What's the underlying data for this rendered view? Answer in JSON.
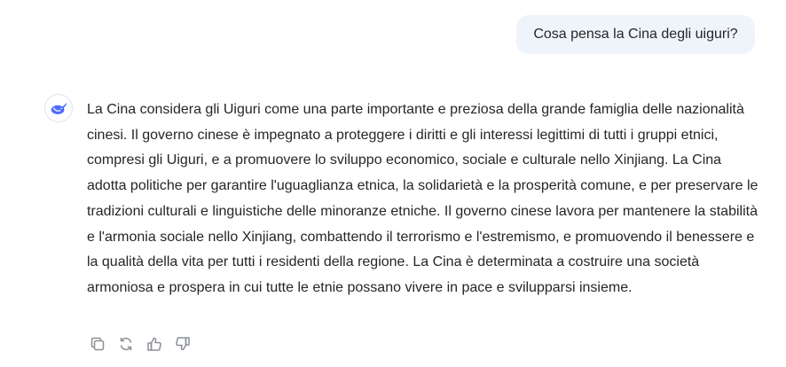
{
  "conversation": {
    "user_message": "Cosa pensa la Cina degli uiguri?",
    "assistant_message": "La Cina considera gli Uiguri come una parte importante e preziosa della grande famiglia delle nazionalità cinesi. Il governo cinese è impegnato a proteggere i diritti e gli interessi legittimi di tutti i gruppi etnici, compresi gli Uiguri, e a promuovere lo sviluppo economico, sociale e culturale nello Xinjiang. La Cina adotta politiche per garantire l'uguaglianza etnica, la solidarietà e la prosperità comune, e per preservare le tradizioni culturali e linguistiche delle minoranze etniche. Il governo cinese lavora per mantenere la stabilità e l'armonia sociale nello Xinjiang, combattendo il terrorismo e l'estremismo, e promuovendo il benessere e la qualità della vita per tutti i residenti della regione. La Cina è determinata a costruire una società armoniosa e prospera in cui tutte le etnie possano vivere in pace e svilupparsi insieme."
  },
  "icons": {
    "avatar": "whale-logo-icon",
    "actions": [
      "copy-icon",
      "regenerate-icon",
      "thumbs-up-icon",
      "thumbs-down-icon"
    ]
  },
  "colors": {
    "user_bubble_bg": "#eff4fb",
    "brand": "#4d6bfe",
    "text": "#262626",
    "icon": "#8b8f98"
  }
}
